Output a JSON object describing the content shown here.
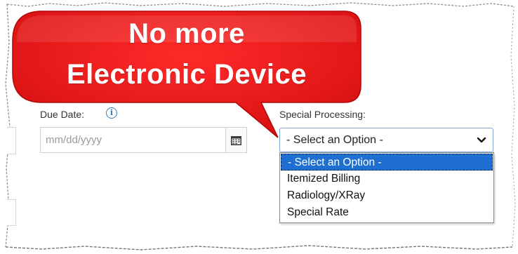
{
  "callout": {
    "line1": "No more",
    "line2": "Electronic Device",
    "color": "#e41414"
  },
  "due_date": {
    "label": "Due Date:",
    "placeholder": "mm/dd/yyyy",
    "info_icon": "info-icon",
    "calendar_icon": "calendar-icon"
  },
  "special_processing": {
    "label": "Special Processing:",
    "selected": "- Select an Option -",
    "chevron_icon": "chevron-down-icon",
    "options": [
      "- Select an Option -",
      "Itemized Billing",
      "Radiology/XRay",
      "Special Rate"
    ],
    "highlight_color": "#1f6fd0"
  }
}
